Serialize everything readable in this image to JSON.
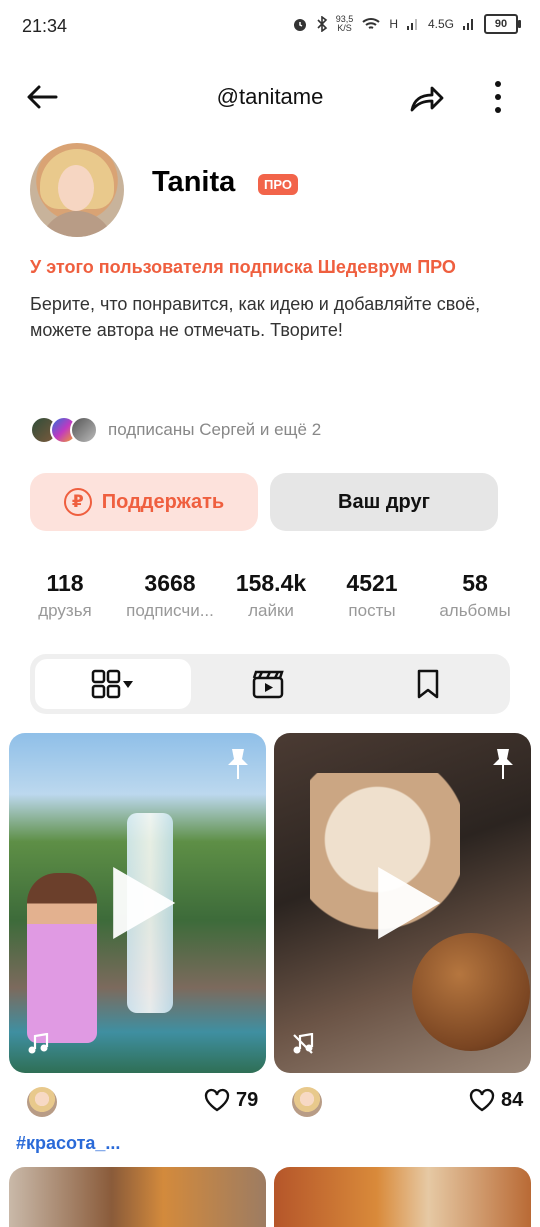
{
  "status_bar": {
    "time": "21:34",
    "net_speed": "93,5",
    "net_unit": "K/S",
    "signal1": "H",
    "signal2": "4.5G",
    "battery": "90"
  },
  "header": {
    "username": "@tanitame"
  },
  "profile": {
    "name": "Tanita",
    "badge": "ПРО",
    "subscription_notice": "У этого пользователя подписка Шедеврум ПРО",
    "bio": "Берите, что понравится, как идею и добавляйте своё, можете автора не отмечать. Творите!",
    "followers_text": "подписаны Сергей и ещё 2"
  },
  "actions": {
    "support_label": "Поддержать",
    "friend_label": "Ваш друг",
    "ruble_symbol": "₽"
  },
  "stats": [
    {
      "value": "118",
      "label": "друзья"
    },
    {
      "value": "3668",
      "label": "подписчи..."
    },
    {
      "value": "158.4k",
      "label": "лайки"
    },
    {
      "value": "4521",
      "label": "посты"
    },
    {
      "value": "58",
      "label": "альбомы"
    }
  ],
  "posts": [
    {
      "likes": "79",
      "tag": "#красота_..."
    },
    {
      "likes": "84"
    }
  ],
  "colors": {
    "accent": "#ef5f3f",
    "tag": "#2a6ad8"
  }
}
